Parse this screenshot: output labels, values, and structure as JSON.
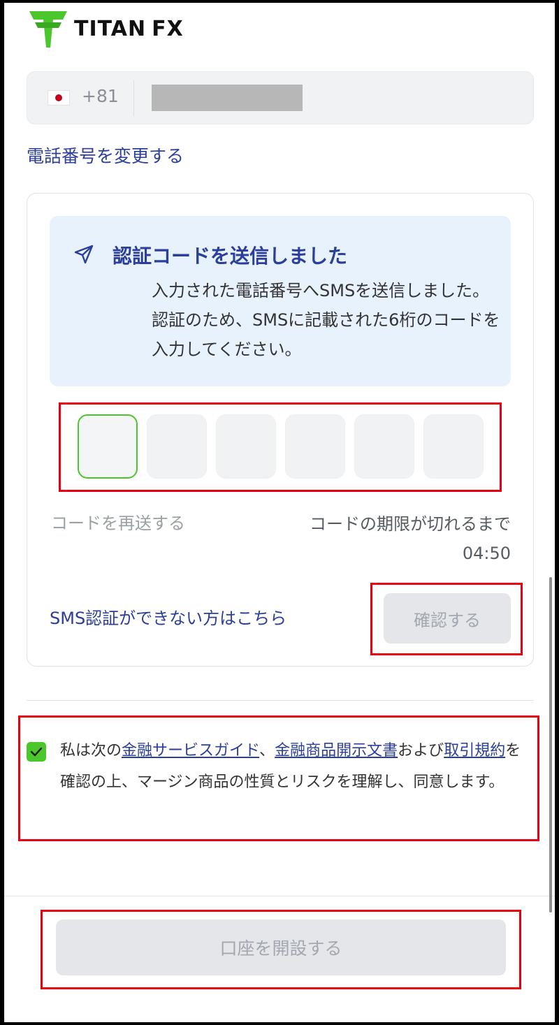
{
  "brand": {
    "name": "TITAN",
    "suffix": "FX",
    "green": "#4cc62d"
  },
  "phone": {
    "country_code": "+81",
    "flag": "japan-flag-icon"
  },
  "change_phone_link": "電話番号を変更する",
  "verification": {
    "title": "認証コードを送信しました",
    "body": "入力された電話番号へSMSを送信しました。認証のため、SMSに記載された6桁のコードを入力してください。",
    "resend_label": "コードを再送する",
    "expire_label": "コードの期限が切れるまで",
    "timer": "04:50",
    "sms_help_link": "SMS認証ができない方はこちら",
    "confirm_button": "確認する"
  },
  "agreement": {
    "checked": true,
    "prefix": "私は次の",
    "link1": "金融サービスガイド",
    "sep1": "、",
    "link2": "金融商品開示文書",
    "sep2": "および",
    "link3": "取引規約",
    "suffix": "を確認の上、マージン商品の性質とリスクを理解し、同意します。"
  },
  "open_account_button": "口座を開設する",
  "colors": {
    "link": "#2b3e9b",
    "highlight": "#e60012",
    "info_bg": "#e8f2fd"
  }
}
